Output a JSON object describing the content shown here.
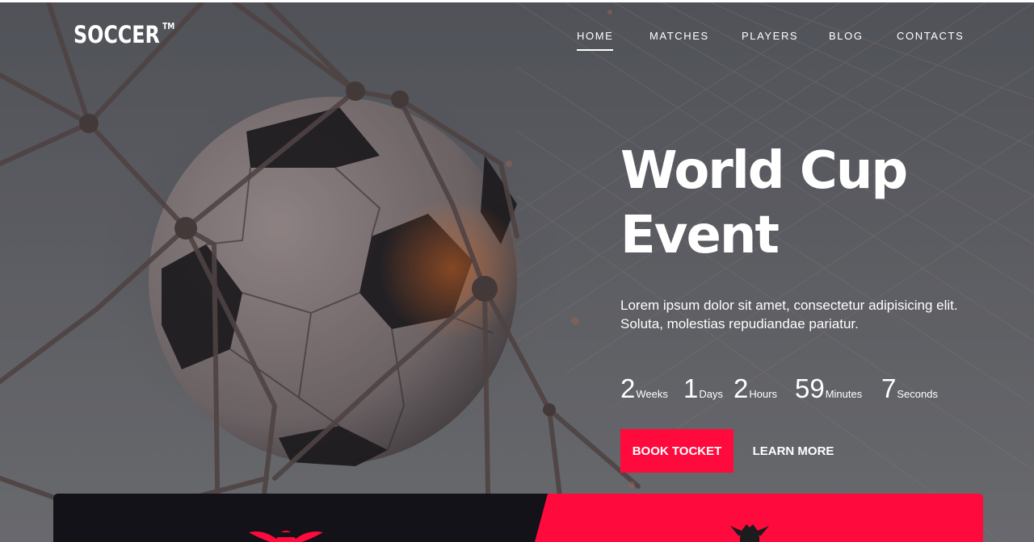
{
  "brand": {
    "name": "SOCCER",
    "mark": "TM"
  },
  "nav": {
    "items": [
      {
        "label": "HOME",
        "active": true
      },
      {
        "label": "MATCHES",
        "active": false
      },
      {
        "label": "PLAYERS",
        "active": false
      },
      {
        "label": "BLOG",
        "active": false
      },
      {
        "label": "CONTACTS",
        "active": false
      }
    ]
  },
  "hero": {
    "title_line1": "World Cup",
    "title_line2": "Event",
    "description": "Lorem ipsum dolor sit amet, consectetur adipisicing elit. Soluta, molestias repudiandae pariatur.",
    "countdown": [
      {
        "value": "2",
        "unit": "Weeks"
      },
      {
        "value": "1",
        "unit": "Days"
      },
      {
        "value": "2",
        "unit": "Hours"
      },
      {
        "value": "59",
        "unit": "Minutes"
      },
      {
        "value": "7",
        "unit": "Seconds"
      }
    ],
    "primary_button": "BOOK TOCKET",
    "secondary_button": "LEARN MORE"
  },
  "match_bar": {
    "left_badge_icon": "football-wings-icon",
    "right_badge_icon": "soccer-eagle-icon"
  },
  "colors": {
    "accent": "#ff0a3c",
    "dark": "#121218"
  }
}
